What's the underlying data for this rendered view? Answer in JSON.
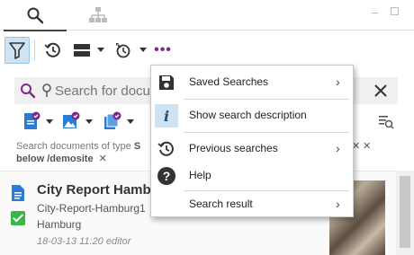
{
  "tabs": [
    {
      "name": "search-icon"
    },
    {
      "name": "hierarchy-icon"
    }
  ],
  "toolbar": {
    "filter": "filter-icon",
    "history": "history-icon",
    "layout": "layout-icon",
    "timer": "timer-icon",
    "more_label": "•••"
  },
  "search": {
    "placeholder": "Search for docu",
    "clear": "clear-icon"
  },
  "type_filter": {
    "line1_prefix": "Search documents of type",
    "line1_strong": "S",
    "line2": "below /demosite",
    "remove_label": "✕"
  },
  "menu": {
    "items": [
      {
        "label": "Saved Searches",
        "has_submenu": true
      },
      {
        "label": "Show search description",
        "highlighted": true
      },
      {
        "label": "Previous searches",
        "has_submenu": true
      },
      {
        "label": "Help"
      },
      {
        "label": "Search result",
        "has_submenu": true
      }
    ],
    "submenu_arrow": "›",
    "info_glyph": "i",
    "help_glyph": "?"
  },
  "result": {
    "title": "City Report Hambur",
    "filename": "City-Report-Hamburg1",
    "location": "Hamburg",
    "meta": "18-03-13 11:20 editor"
  },
  "colors": {
    "accent_purple": "#7b2a8c",
    "doc_blue": "#2b7cd3",
    "check_green": "#39b54a",
    "active_filter_bg": "#cfe3f3"
  }
}
